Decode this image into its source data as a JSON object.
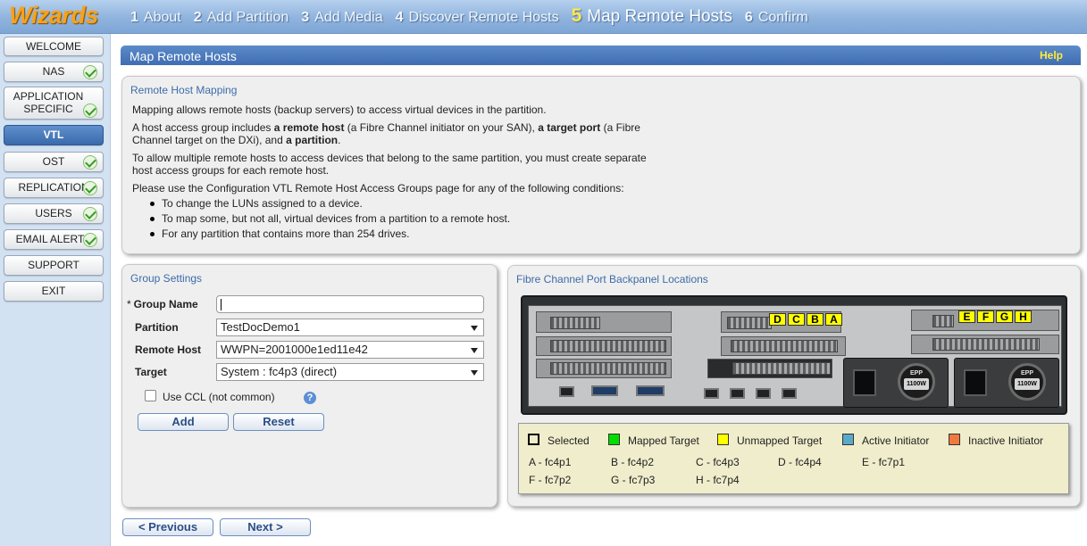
{
  "app": {
    "logo": "Wizards"
  },
  "steps": [
    {
      "num": "1",
      "label": "About"
    },
    {
      "num": "2",
      "label": "Add Partition"
    },
    {
      "num": "3",
      "label": "Add Media"
    },
    {
      "num": "4",
      "label": "Discover Remote Hosts"
    },
    {
      "num": "5",
      "label": "Map Remote Hosts"
    },
    {
      "num": "6",
      "label": "Confirm"
    }
  ],
  "active_step": "5",
  "nav": {
    "welcome": "WELCOME",
    "nas": "NAS",
    "application_specific": "APPLICATION SPECIFIC",
    "vtl": "VTL",
    "ost": "OST",
    "replication": "REPLICATION",
    "users": "USERS",
    "email_alerts": "EMAIL ALERTS",
    "support": "SUPPORT",
    "exit": "EXIT"
  },
  "header": {
    "title": "Map Remote Hosts",
    "help": "Help"
  },
  "mapping": {
    "title": "Remote Host Mapping",
    "p1": "Mapping allows remote hosts (backup servers) to access virtual devices in the partition.",
    "p2_a": "A host access group includes ",
    "p2_b": "a remote host",
    "p2_c": " (a Fibre Channel initiator on your SAN), ",
    "p2_d": "a target port",
    "p2_e": " (a Fibre Channel target on the DXi), and ",
    "p2_f": "a partition",
    "p2_g": ".",
    "p3": "To allow multiple remote hosts to access devices that belong to the same partition, you must create separate host access groups for each remote host.",
    "p4": "Please use the Configuration VTL Remote Host Access Groups page for any of the following conditions:",
    "bullets": [
      "To change the LUNs assigned to a device.",
      "To map some, but not all, virtual devices from a partition to a remote host.",
      "For any partition that contains more than 254 drives."
    ]
  },
  "group_settings": {
    "title": "Group Settings",
    "group_name_label": "Group Name",
    "required_mark": "*",
    "group_name_value": "",
    "partition_label": "Partition",
    "partition_value": "TestDocDemo1",
    "remote_host_label": "Remote Host",
    "remote_host_value": "WWPN=2001000e1ed11e42",
    "target_label": "Target",
    "target_value": "System : fc4p3 (direct)",
    "ccl_label": "Use CCL (not common)",
    "ccl_checked": false,
    "help_glyph": "?",
    "add": "Add",
    "reset": "Reset"
  },
  "backpanel": {
    "title": "Fibre Channel Port Backpanel Locations",
    "psu_label": "1100W",
    "psu_brand": "EPP",
    "ports": [
      "D",
      "C",
      "B",
      "A",
      "E",
      "F",
      "G",
      "H"
    ],
    "legend": [
      {
        "label": "Selected",
        "color": "#000000",
        "fill": "none"
      },
      {
        "label": "Mapped Target",
        "color": "#00dd00"
      },
      {
        "label": "Unmapped Target",
        "color": "#ffff00"
      },
      {
        "label": "Active Initiator",
        "color": "#5aa9c9"
      },
      {
        "label": "Inactive Initiator",
        "color": "#f07a3e"
      }
    ],
    "port_map": [
      "A - fc4p1",
      "B - fc4p2",
      "C - fc4p3",
      "D - fc4p4",
      "E - fc7p1",
      "F - fc7p2",
      "G - fc7p3",
      "H - fc7p4"
    ]
  },
  "footer": {
    "previous": "< Previous",
    "next": "Next >"
  }
}
